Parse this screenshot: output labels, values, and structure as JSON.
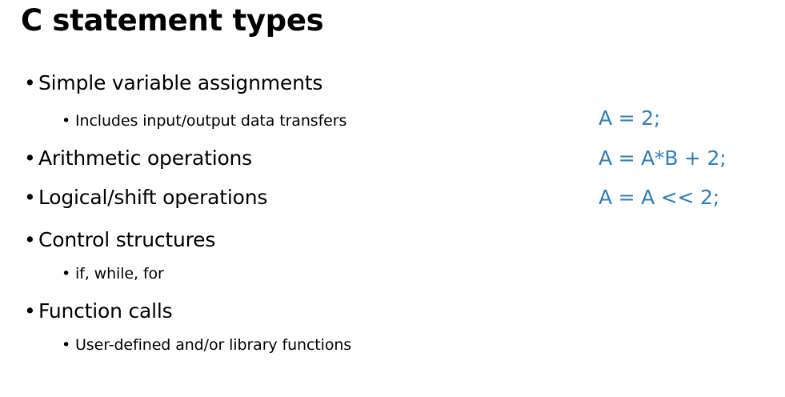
{
  "slide": {
    "title": "C statement types",
    "bullet_char": "•",
    "items": [
      {
        "text": "Simple variable assignments"
      },
      {
        "text": "Includes input/output data transfers"
      },
      {
        "text": "Arithmetic operations"
      },
      {
        "text": "Logical/shift operations"
      },
      {
        "text": "Control structures"
      },
      {
        "text": "if, while, for"
      },
      {
        "text": "Function calls"
      },
      {
        "text": "User-defined and/or library functions"
      }
    ],
    "code_examples": [
      "A = 2;",
      "A = A*B + 2;",
      "A = A << 2;"
    ],
    "code_color": "#2F7FC1"
  }
}
